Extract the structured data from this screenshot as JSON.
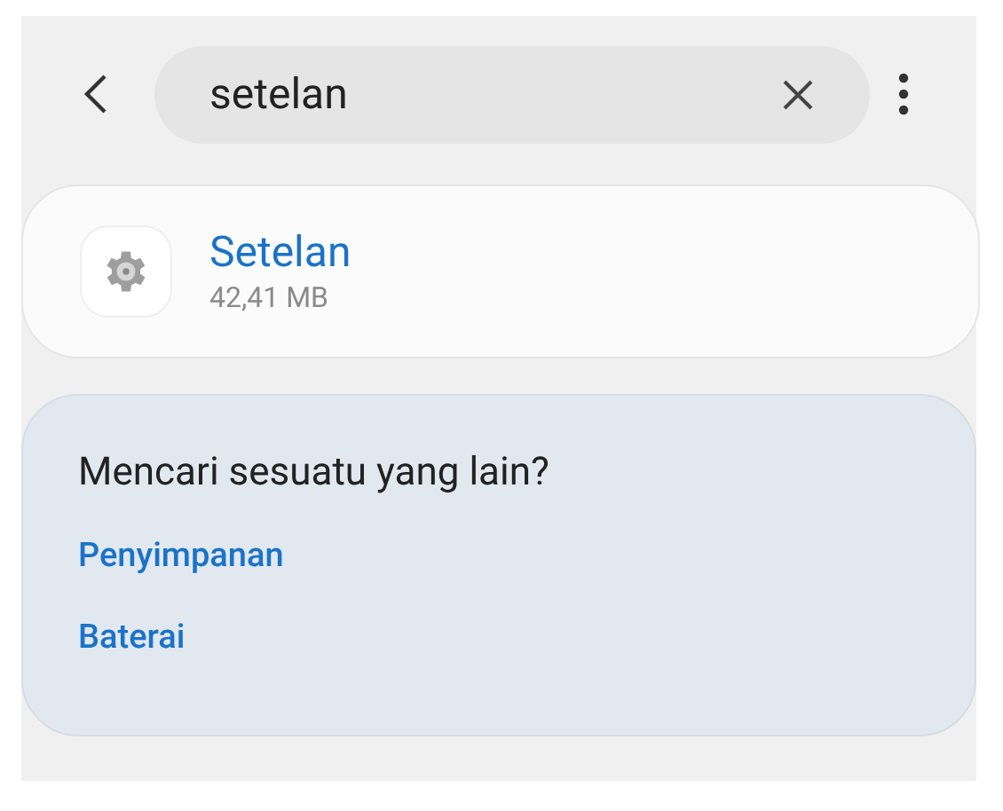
{
  "search": {
    "value": "setelan"
  },
  "results": [
    {
      "title": "Setelan",
      "size": "42,41 MB"
    }
  ],
  "suggestions": {
    "heading": "Mencari sesuatu yang lain?",
    "links": [
      "Penyimpanan",
      "Baterai"
    ]
  }
}
